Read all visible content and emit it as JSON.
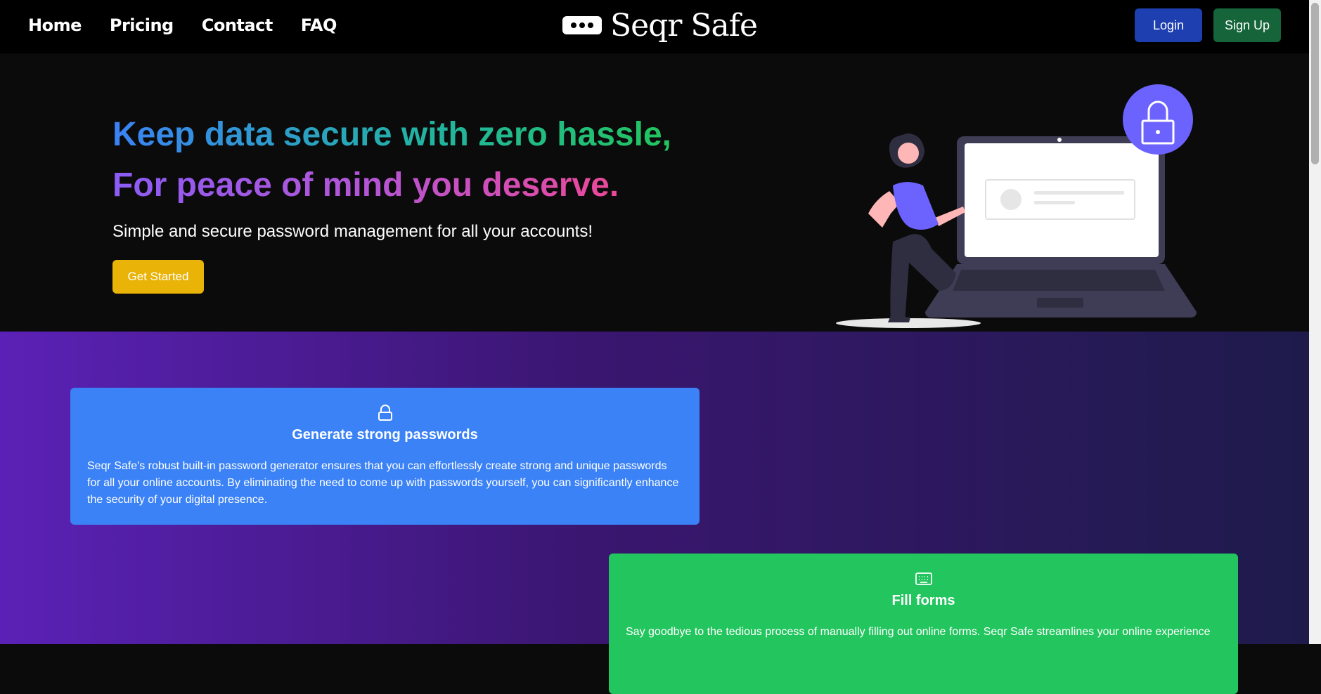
{
  "nav": {
    "links": [
      "Home",
      "Pricing",
      "Contact",
      "FAQ"
    ],
    "brand": "Seqr Safe",
    "login_label": "Login",
    "signup_label": "Sign Up"
  },
  "hero": {
    "title_line1": "Keep data secure with zero hassle,",
    "title_line2": "For peace of mind you deserve.",
    "subtitle": "Simple and secure password management for all your accounts!",
    "cta_label": "Get Started"
  },
  "features": [
    {
      "icon": "lock-icon",
      "title": "Generate strong passwords",
      "text": "Seqr Safe's robust built-in password generator ensures that you can effortlessly create strong and unique passwords for all your online accounts. By eliminating the need to come up with passwords yourself, you can significantly enhance the security of your digital presence.",
      "color": "#3b82f6"
    },
    {
      "icon": "keyboard-icon",
      "title": "Fill forms",
      "text": "Say goodbye to the tedious process of manually filling out online forms. Seqr Safe streamlines your online experience",
      "color": "#22c55e"
    }
  ],
  "colors": {
    "login": "#1e3fb0",
    "signup": "#16653a",
    "cta": "#eab308",
    "illustration_accent": "#6c63ff"
  }
}
